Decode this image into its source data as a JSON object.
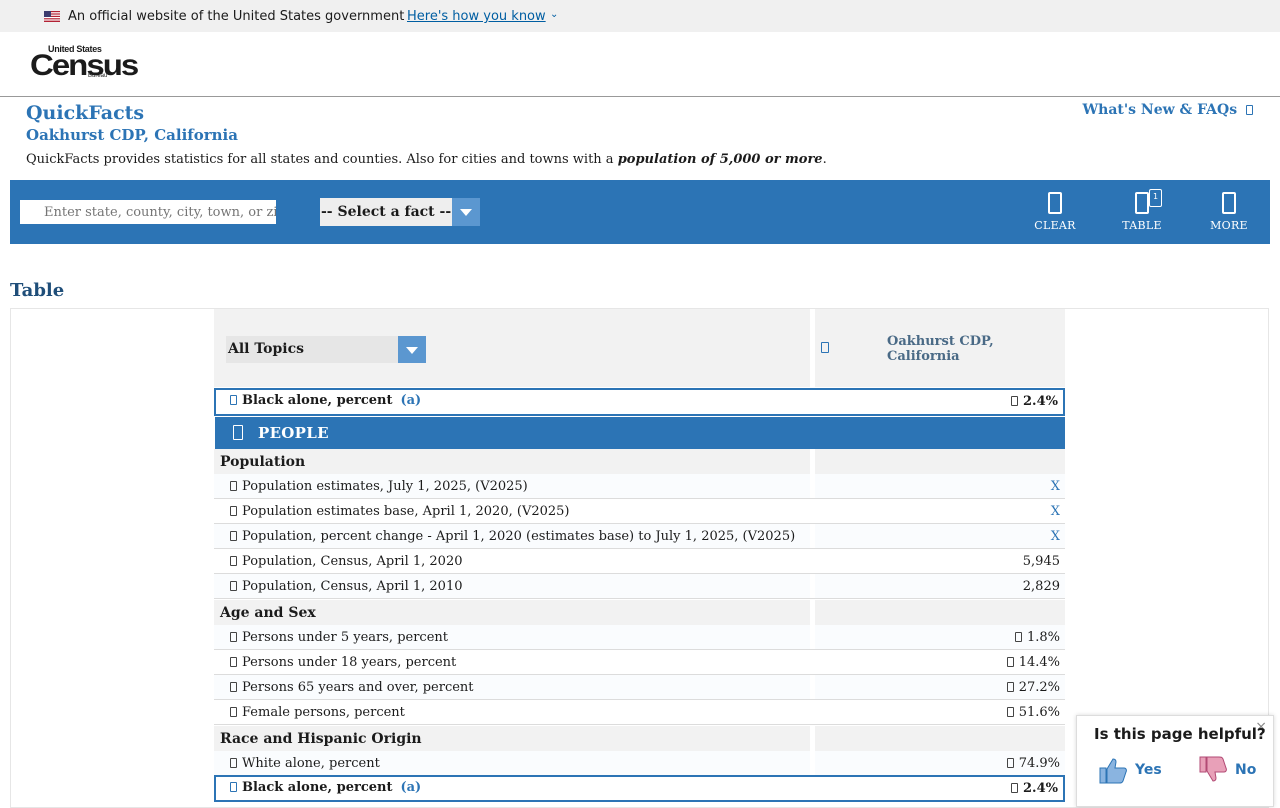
{
  "gov_banner": {
    "text": "An official website of the United States government",
    "link": "Here's how you know",
    "flag_icon": "us-flag-icon"
  },
  "logo": {
    "top": "United States",
    "main": "Census",
    "bottom": "Bureau"
  },
  "header": {
    "title": "QuickFacts",
    "subtitle": "Oakhurst CDP, California",
    "whats_new": "What's New & FAQs",
    "desc_prefix": "QuickFacts provides statistics for all states and counties. Also for cities and towns with a ",
    "desc_emphasis": "population of 5,000 or more",
    "desc_suffix": "."
  },
  "toolbar": {
    "search_placeholder": "Enter state, county, city, town, or zip code",
    "fact_select": "-- Select a fact --",
    "clear_label": "CLEAR",
    "table_label": "TABLE",
    "table_badge": "1",
    "more_label": "MORE"
  },
  "section": {
    "heading": "Table"
  },
  "table": {
    "topics_select": "All Topics",
    "location_line1": "Oakhurst CDP,",
    "location_line2": "California",
    "selected_row": {
      "label": "Black alone, percent",
      "note": "(a)",
      "value": "2.4%"
    },
    "people_header": "PEOPLE",
    "categories": {
      "population": "Population",
      "age_sex": "Age and Sex",
      "race": "Race and Hispanic Origin"
    },
    "rows": [
      {
        "label": "Population estimates, July 1, 2025, (V2025)",
        "value": "X"
      },
      {
        "label": "Population estimates base, April 1, 2020, (V2025)",
        "value": "X"
      },
      {
        "label": "Population, percent change - April 1, 2020 (estimates base) to July 1, 2025, (V2025)",
        "value": "X"
      },
      {
        "label": "Population, Census, April 1, 2020",
        "value": "5,945"
      },
      {
        "label": "Population, Census, April 1, 2010",
        "value": "2,829"
      },
      {
        "label": "Persons under 5 years, percent",
        "value": "1.8%"
      },
      {
        "label": "Persons under 18 years, percent",
        "value": "14.4%"
      },
      {
        "label": "Persons 65 years and over, percent",
        "value": "27.2%"
      },
      {
        "label": "Female persons, percent",
        "value": "51.6%"
      },
      {
        "label": "White alone, percent",
        "value": "74.9%"
      }
    ],
    "bottom_selected_row": {
      "label": "Black alone, percent",
      "note": "(a)",
      "value": "2.4%"
    }
  },
  "feedback": {
    "title": "Is this page helpful?",
    "yes": "Yes",
    "no": "No",
    "close": "×"
  },
  "colors": {
    "primary": "#2c74b5",
    "heading": "#1f4e79",
    "select_arrow": "#5b97d0"
  }
}
